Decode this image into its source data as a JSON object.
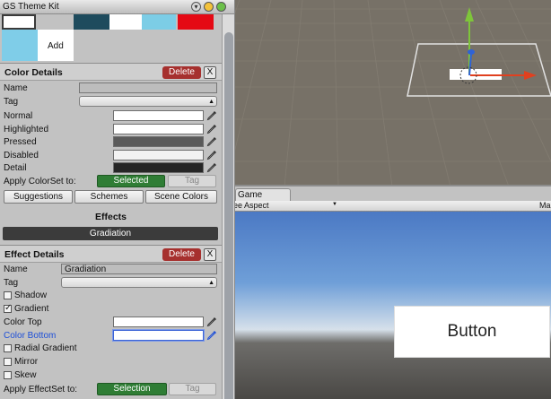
{
  "window": {
    "title": "GS Theme Kit"
  },
  "swatches": {
    "colors": [
      "#1e4b5d",
      "#ffffff",
      "#7ccde6",
      "#e50914"
    ],
    "selected_color": "#7fcde8",
    "add_label": "Add"
  },
  "color_details": {
    "title": "Color Details",
    "delete_label": "Delete",
    "close_label": "X",
    "name_label": "Name",
    "name_value": "",
    "tag_label": "Tag",
    "tag_value": "",
    "rows": [
      {
        "label": "Normal",
        "color": "#ffffff"
      },
      {
        "label": "Highlighted",
        "color": "#ffffff"
      },
      {
        "label": "Pressed",
        "color": "#5a5a5a"
      },
      {
        "label": "Disabled",
        "color": "#f2f2f2"
      },
      {
        "label": "Detail",
        "color": "#262626"
      }
    ],
    "apply_label": "Apply ColorSet to:",
    "selected_button": "Selected",
    "tag_button": "Tag"
  },
  "tabs": [
    "Suggestions",
    "Schemes",
    "Scene Colors"
  ],
  "effects": {
    "heading": "Effects",
    "current": "Gradiation"
  },
  "effect_details": {
    "title": "Effect Details",
    "delete_label": "Delete",
    "close_label": "X",
    "name_label": "Name",
    "name_value": "Gradiation",
    "tag_label": "Tag",
    "tag_value": "",
    "options": [
      {
        "label": "Shadow",
        "checked": false
      },
      {
        "label": "Gradient",
        "checked": true
      }
    ],
    "color_top_label": "Color Top",
    "color_top": "#ffffff",
    "color_bottom_label": "Color Bottom",
    "color_bottom": "#ffffff",
    "more_options": [
      {
        "label": "Radial Gradient",
        "checked": false
      },
      {
        "label": "Mirror",
        "checked": false
      },
      {
        "label": "Skew",
        "checked": false
      }
    ],
    "apply_label": "Apply EffectSet to:",
    "selection_button": "Selection",
    "tag_button": "Tag"
  },
  "game": {
    "tab_label": "Game",
    "aspect_label": "ee Aspect",
    "maximize_label": "Ma",
    "button_text": "Button"
  },
  "colors": {
    "delete_red": "#a6302e",
    "apply_green": "#2f7d35",
    "link_blue": "#1d4fd8",
    "scene_bg": "#777167",
    "gizmo_y": "#7ec53a",
    "gizmo_x": "#e0401f",
    "gizmo_z": "#2f62d6"
  }
}
